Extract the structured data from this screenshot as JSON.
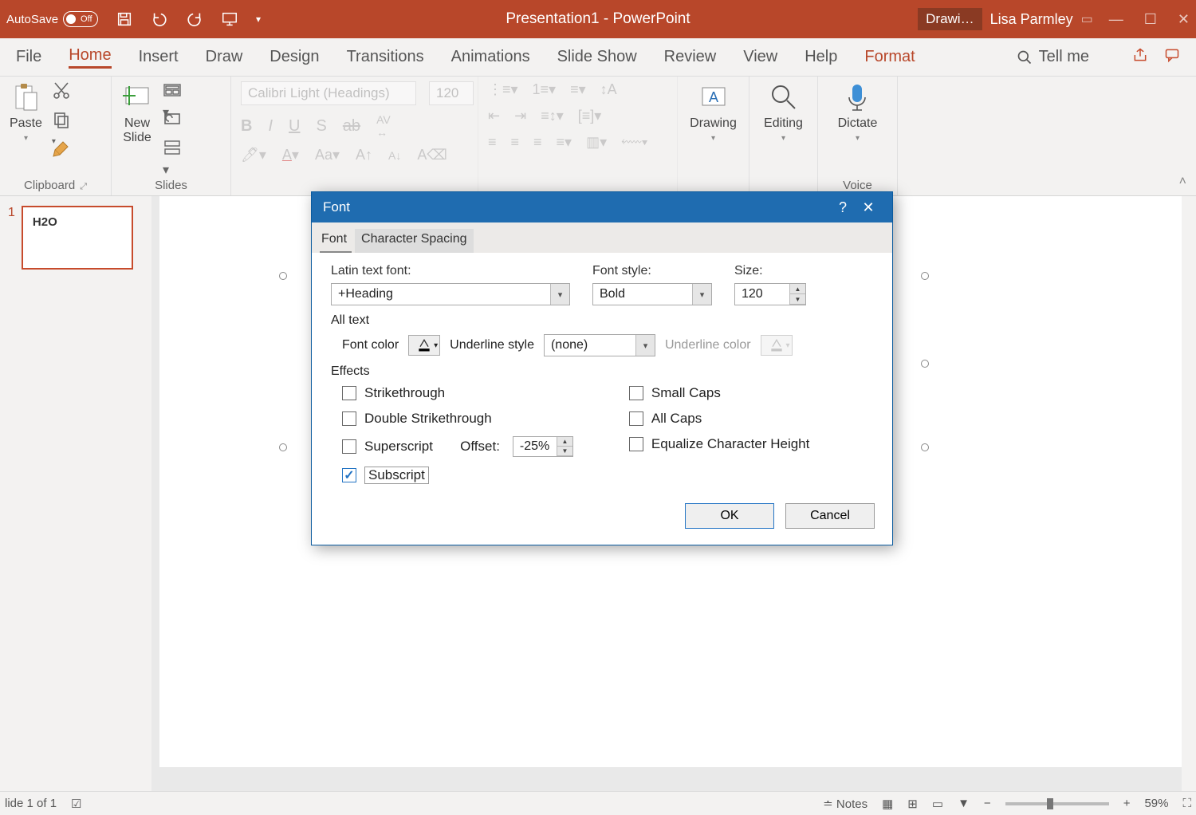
{
  "titlebar": {
    "autosave_label": "AutoSave",
    "autosave_state": "Off",
    "doc_title": "Presentation1  -  PowerPoint",
    "context_tab": "Drawi…",
    "username": "Lisa Parmley"
  },
  "ribbon_tabs": [
    "File",
    "Home",
    "Insert",
    "Draw",
    "Design",
    "Transitions",
    "Animations",
    "Slide Show",
    "Review",
    "View",
    "Help"
  ],
  "ribbon_context_tab": "Format",
  "tell_me": "Tell me",
  "ribbon": {
    "clipboard": {
      "paste": "Paste",
      "group": "Clipboard"
    },
    "slides": {
      "new_slide": "New\nSlide",
      "group": "Slides"
    },
    "font": {
      "font_name": "Calibri Light (Headings)",
      "font_size": "120"
    },
    "drawing": {
      "label": "Drawing"
    },
    "editing": {
      "label": "Editing"
    },
    "voice": {
      "dictate": "Dictate",
      "group": "Voice"
    }
  },
  "thumb": {
    "number": "1",
    "text": "H2O"
  },
  "status": {
    "slide_info": "lide 1 of 1",
    "notes": "Notes",
    "zoom": "59%"
  },
  "dialog": {
    "title": "Font",
    "tabs": {
      "font": "Font",
      "spacing": "Character Spacing"
    },
    "latin_label": "Latin text font:",
    "latin_value": "+Heading",
    "style_label": "Font style:",
    "style_value": "Bold",
    "size_label": "Size:",
    "size_value": "120",
    "all_text_label": "All text",
    "font_color_label": "Font color",
    "underline_style_label": "Underline style",
    "underline_style_value": "(none)",
    "underline_color_label": "Underline color",
    "effects_label": "Effects",
    "effects": {
      "strike": "Strikethrough",
      "dstrike": "Double Strikethrough",
      "superscript": "Superscript",
      "subscript": "Subscript",
      "smallcaps": "Small Caps",
      "allcaps": "All Caps",
      "equalize": "Equalize Character Height"
    },
    "offset_label": "Offset:",
    "offset_value": "-25%",
    "ok": "OK",
    "cancel": "Cancel"
  }
}
